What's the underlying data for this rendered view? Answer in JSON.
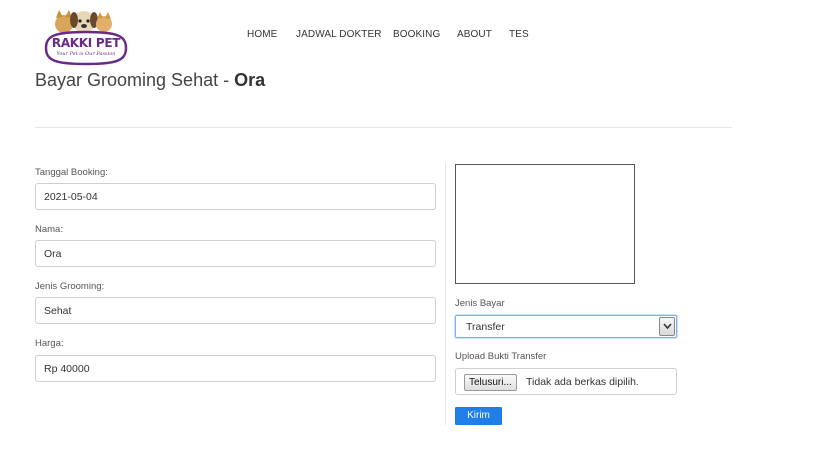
{
  "brand": {
    "name": "RAKKI PET",
    "tagline": "Your Pet is Our Passion"
  },
  "nav": {
    "items": [
      {
        "label": "HOME"
      },
      {
        "label": "JADWAL DOKTER"
      },
      {
        "label": "BOOKING"
      },
      {
        "label": "ABOUT"
      },
      {
        "label": "TES"
      }
    ]
  },
  "page": {
    "title_prefix": "Bayar Grooming Sehat - ",
    "title_name": "Ora"
  },
  "form": {
    "tanggal": {
      "label": "Tanggal Booking:",
      "value": "2021-05-04"
    },
    "nama": {
      "label": "Nama:",
      "value": "Ora"
    },
    "jenis": {
      "label": "Jenis Grooming:",
      "value": "Sehat"
    },
    "harga": {
      "label": "Harga:",
      "value": "Rp 40000"
    },
    "jenis_bayar": {
      "label": "Jenis Bayar",
      "selected": "Transfer"
    },
    "upload": {
      "label": "Upload Bukti Transfer",
      "button": "Telusuri...",
      "no_file": "Tidak ada berkas dipilih."
    },
    "submit_label": "Kirim"
  },
  "colors": {
    "brand_purple": "#6a2a8a",
    "primary_button": "#1f7ee8"
  }
}
